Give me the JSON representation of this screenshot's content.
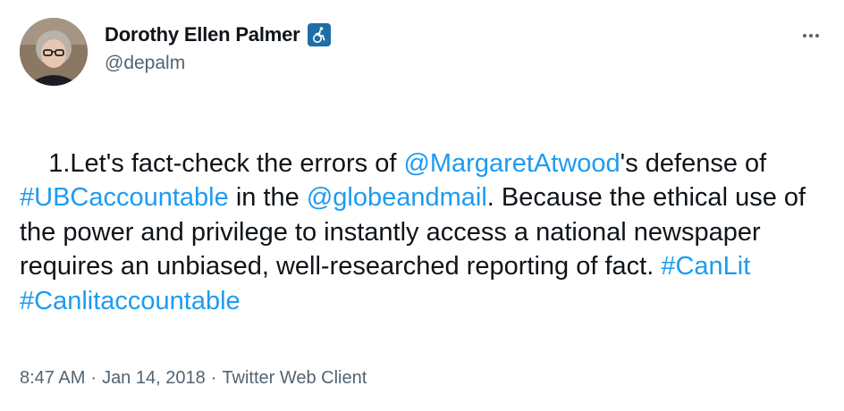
{
  "user": {
    "display_name": "Dorothy Ellen Palmer",
    "handle": "@depalm",
    "badge_icon": "accessibility-wheelchair-icon",
    "badge_color": "#1f6ea8"
  },
  "tweet": {
    "segments": [
      {
        "text": "1.Let's fact-check the errors of ",
        "link": false
      },
      {
        "text": "@MargaretAtwood",
        "link": true
      },
      {
        "text": "'s defense of  ",
        "link": false
      },
      {
        "text": "#UBCaccountable",
        "link": true
      },
      {
        "text": " in the ",
        "link": false
      },
      {
        "text": "@globeandmail",
        "link": true
      },
      {
        "text": ". Because the ethical use of the power and privilege to instantly access a national newspaper requires an unbiased, well-researched reporting of fact. ",
        "link": false
      },
      {
        "text": "#CanLit",
        "link": true
      },
      {
        "text": " ",
        "link": false
      },
      {
        "text": "#Canlitaccountable",
        "link": true
      }
    ]
  },
  "meta": {
    "time": "8:47 AM",
    "separator": "·",
    "date": "Jan 14, 2018",
    "client": "Twitter Web Client"
  },
  "colors": {
    "link": "#1d9bf0",
    "text": "#0f1419",
    "secondary": "#536471"
  }
}
